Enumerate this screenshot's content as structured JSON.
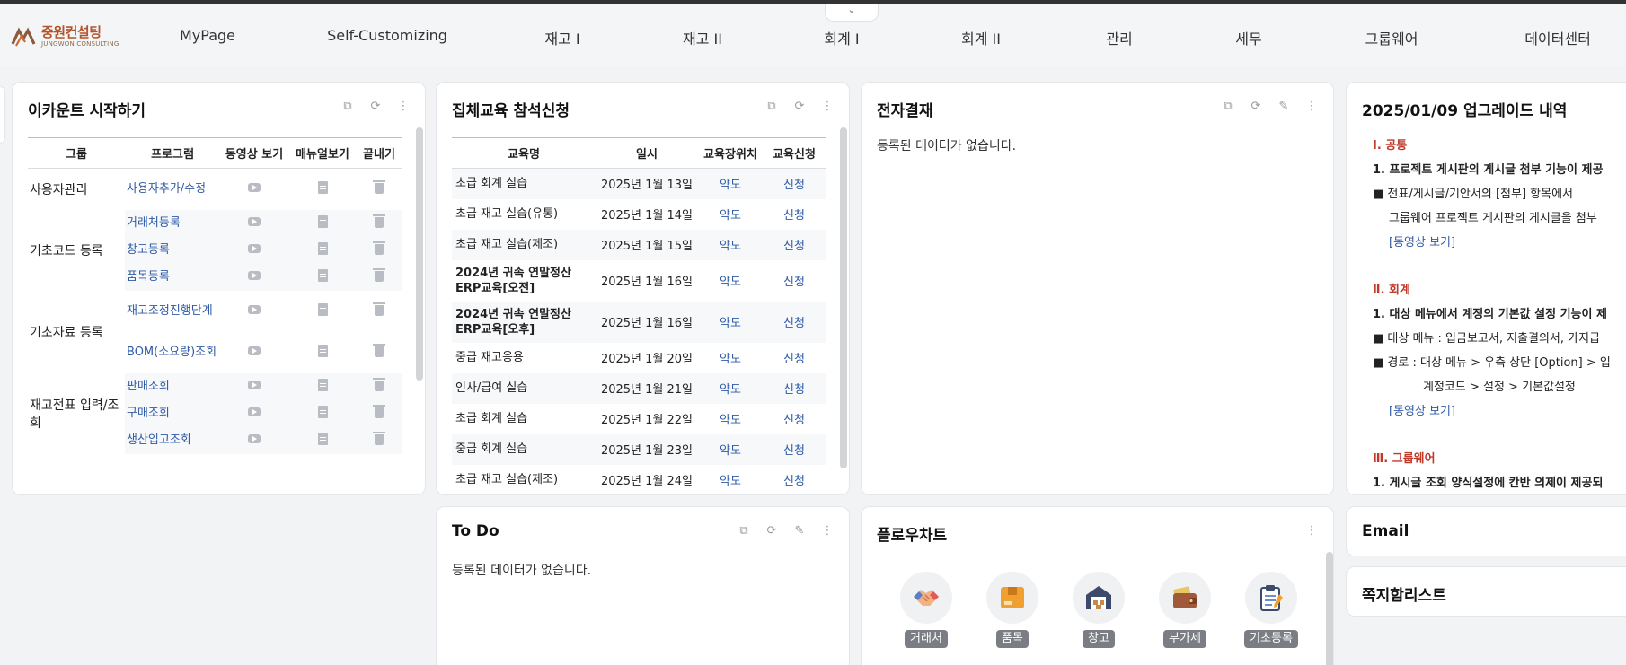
{
  "header": {
    "logo_ko": "중원컨설팅",
    "logo_en": "JUNGWON CONSULTING",
    "nav": [
      "MyPage",
      "Self-Customizing",
      "재고 I",
      "재고 II",
      "회계 I",
      "회계 II",
      "관리",
      "세무",
      "그룹웨어",
      "데이터센터"
    ]
  },
  "start": {
    "title": "이카운트 시작하기",
    "columns": [
      "그룹",
      "프로그램",
      "동영상 보기",
      "매뉴얼보기",
      "끝내기"
    ],
    "groups": [
      {
        "name": "사용자관리",
        "programs": [
          "사용자추가/수정"
        ]
      },
      {
        "name": "기초코드 등록",
        "programs": [
          "거래처등록",
          "창고등록",
          "품목등록"
        ]
      },
      {
        "name": "기초자료 등록",
        "programs": [
          "재고조정진행단계",
          "BOM(소요량)조회"
        ]
      },
      {
        "name": "재고전표 입력/조회",
        "programs": [
          "판매조회",
          "구매조회",
          "생산입고조회"
        ]
      }
    ]
  },
  "training": {
    "title": "집체교육 참석신청",
    "columns": [
      "교육명",
      "일시",
      "교육장위치",
      "교육신청"
    ],
    "map_label": "약도",
    "apply_label": "신청",
    "rows": [
      {
        "name": "초급 회계 실습",
        "date": "2025년 1월 13일",
        "bold": false
      },
      {
        "name": "초급 재고 실습(유통)",
        "date": "2025년 1월 14일",
        "bold": false
      },
      {
        "name": "초급 재고 실습(제조)",
        "date": "2025년 1월 15일",
        "bold": false
      },
      {
        "name": "2024년 귀속 연말정산ERP교육[오전]",
        "date": "2025년 1월 16일",
        "bold": true
      },
      {
        "name": "2024년 귀속 연말정산ERP교육[오후]",
        "date": "2025년 1월 16일",
        "bold": true
      },
      {
        "name": "중급 재고응용",
        "date": "2025년 1월 20일",
        "bold": false
      },
      {
        "name": "인사/급여 실습",
        "date": "2025년 1월 21일",
        "bold": false
      },
      {
        "name": "초급 회계 실습",
        "date": "2025년 1월 22일",
        "bold": false
      },
      {
        "name": "중급 회계 실습",
        "date": "2025년 1월 23일",
        "bold": false
      },
      {
        "name": "초급 재고 실습(제조)",
        "date": "2025년 1월 24일",
        "bold": false
      }
    ]
  },
  "approval": {
    "title": "전자결재",
    "empty": "등록된 데이터가 없습니다."
  },
  "upgrade": {
    "title": "2025/01/09 업그레이드 내역",
    "s1": "Ⅰ. 공통",
    "s1_item": "1. 프로젝트 게시판의 게시글 첨부 기능이 제공",
    "s1_b1": "■ 전표/게시글/기안서의 [첨부] 항목에서",
    "s1_b1_cont": "그룹웨어 프로젝트 게시판의 게시글을 첨부",
    "s1_link": "[동영상 보기]",
    "s2": "Ⅱ. 회계",
    "s2_item": "1. 대상 메뉴에서 계정의 기본값 설정 기능이 제",
    "s2_b1": "■ 대상 메뉴 : 입금보고서, 지출결의서, 가지급",
    "s2_b2": "■ 경로 : 대상 메뉴 > 우측 상단 [Option] > 입",
    "s2_b2_cont": "계정코드 > 설정 > 기본값설정",
    "s2_link": "[동영상 보기]",
    "s3": "Ⅲ. 그룹웨어",
    "s3_item": "1. 게시글 조회 양식설정에 칸반 의제이 제공되"
  },
  "todo": {
    "title": "To Do",
    "empty": "등록된 데이터가 없습니다."
  },
  "flowchart": {
    "title": "플로우차트",
    "items": [
      {
        "label": "거래처",
        "icon": "handshake-icon"
      },
      {
        "label": "품목",
        "icon": "box-icon"
      },
      {
        "label": "창고",
        "icon": "warehouse-icon"
      },
      {
        "label": "부가세",
        "icon": "wallet-icon"
      },
      {
        "label": "기초등록",
        "icon": "clipboard-icon"
      }
    ]
  },
  "email": {
    "title": "Email"
  },
  "memo": {
    "title": "쪽지함리스트"
  }
}
